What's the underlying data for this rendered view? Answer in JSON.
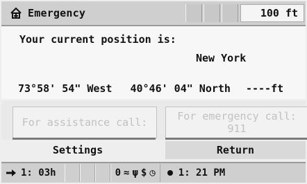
{
  "header": {
    "title": "Emergency",
    "altitude": "100 ft"
  },
  "position": {
    "intro": "Your current position is:",
    "city": "New York",
    "longitude": "73°58' 54\" West",
    "latitude": "40°46' 04\" North",
    "elevation": "----ft"
  },
  "buttons": {
    "assistance_label": "For assistance call:",
    "emergency_label": "For emergency call:",
    "emergency_number": "911"
  },
  "softkeys": {
    "settings": "Settings",
    "return": "Return"
  },
  "status": {
    "eta": "1: 03h",
    "satellites": "0",
    "time": "1: 21 PM",
    "icons": [
      "satellite-icon",
      "signal-icon",
      "dollar-icon",
      "clock-icon"
    ]
  }
}
